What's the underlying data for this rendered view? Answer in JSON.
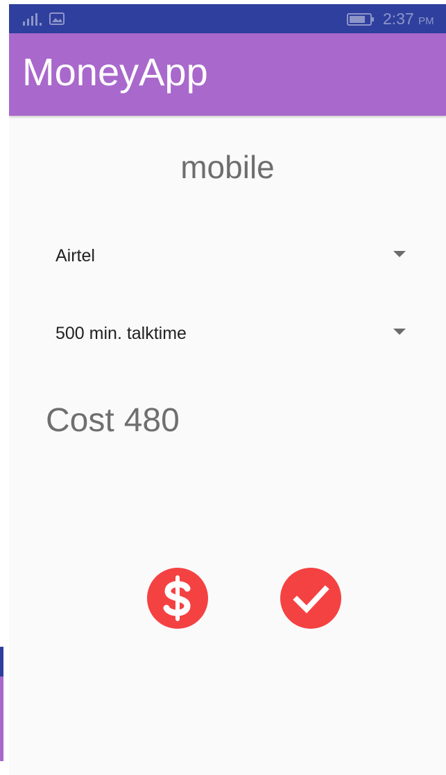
{
  "status_bar": {
    "icons": [
      "signal-icon",
      "gallery-icon",
      "battery-icon"
    ],
    "time": "2:37",
    "ampm": "PM"
  },
  "app_bar": {
    "title": "MoneyApp"
  },
  "category": "mobile",
  "operator_spinner": {
    "selected": "Airtel"
  },
  "plan_spinner": {
    "selected": "500 min. talktime"
  },
  "cost": {
    "label": "Cost",
    "value": "480"
  },
  "actions": {
    "pay_icon": "dollar-icon",
    "confirm_icon": "check-icon"
  },
  "colors": {
    "status_bar": "#2f3f9e",
    "app_bar": "#a968cb",
    "fab": "#f44242",
    "background": "#fafafa"
  }
}
